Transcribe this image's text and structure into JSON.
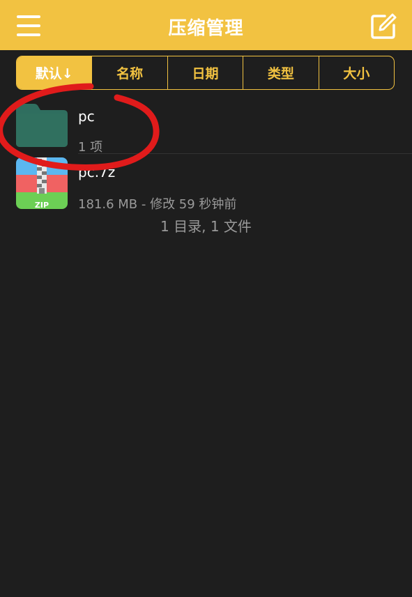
{
  "header": {
    "title": "压缩管理"
  },
  "sort": {
    "tabs": [
      {
        "label": "默认↓",
        "active": true
      },
      {
        "label": "名称",
        "active": false
      },
      {
        "label": "日期",
        "active": false
      },
      {
        "label": "类型",
        "active": false
      },
      {
        "label": "大小",
        "active": false
      }
    ]
  },
  "files": [
    {
      "name": "pc",
      "meta": "1 项",
      "icon": "folder-icon"
    },
    {
      "name": "pc.7z",
      "meta": "181.6 MB - 修改 59 秒钟前",
      "icon": "zip-archive-icon",
      "icon_text": "ZIP"
    }
  ],
  "summary": "1 目录, 1 文件",
  "colors": {
    "accent": "#f2c241",
    "background": "#1e1e1e",
    "folder": "#2f6e5f",
    "annotation": "#e01b1b"
  }
}
